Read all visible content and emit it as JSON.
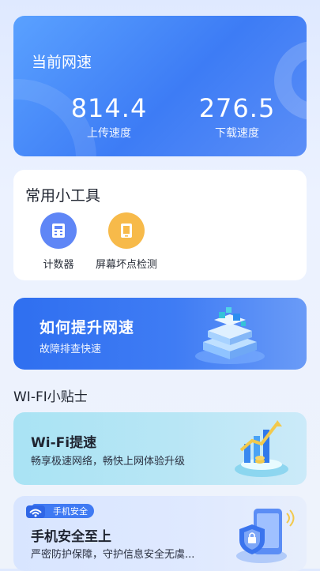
{
  "speed_card": {
    "title": "当前网速",
    "upload_value": "814.4",
    "upload_label": "上传速度",
    "download_value": "276.5",
    "download_label": "下载速度"
  },
  "tools_card": {
    "title": "常用小工具",
    "items": [
      {
        "label": "计数器",
        "icon": "calculator-icon",
        "color": "#5f86f6"
      },
      {
        "label": "屏幕坏点检测",
        "icon": "screen-check-icon",
        "color": "#f7ba4a"
      }
    ]
  },
  "speed_banner": {
    "title": "如何提升网速",
    "subtitle": "故障排查快速"
  },
  "tips_section": {
    "title": "WI-FI小贴士"
  },
  "wifi_tip": {
    "title": "Wi-Fi提速",
    "subtitle": "畅享极速网络，畅快上网体验升级"
  },
  "security_tip": {
    "badge": "手机安全",
    "title": "手机安全至上",
    "subtitle": "严密防护保障，守护信息安全无虞..."
  },
  "colors": {
    "primary_blue": "#3d7cf5",
    "tool_blue": "#5f86f6",
    "tool_orange": "#f7ba4a",
    "wifi_card_bg": "#b8e6f5"
  }
}
